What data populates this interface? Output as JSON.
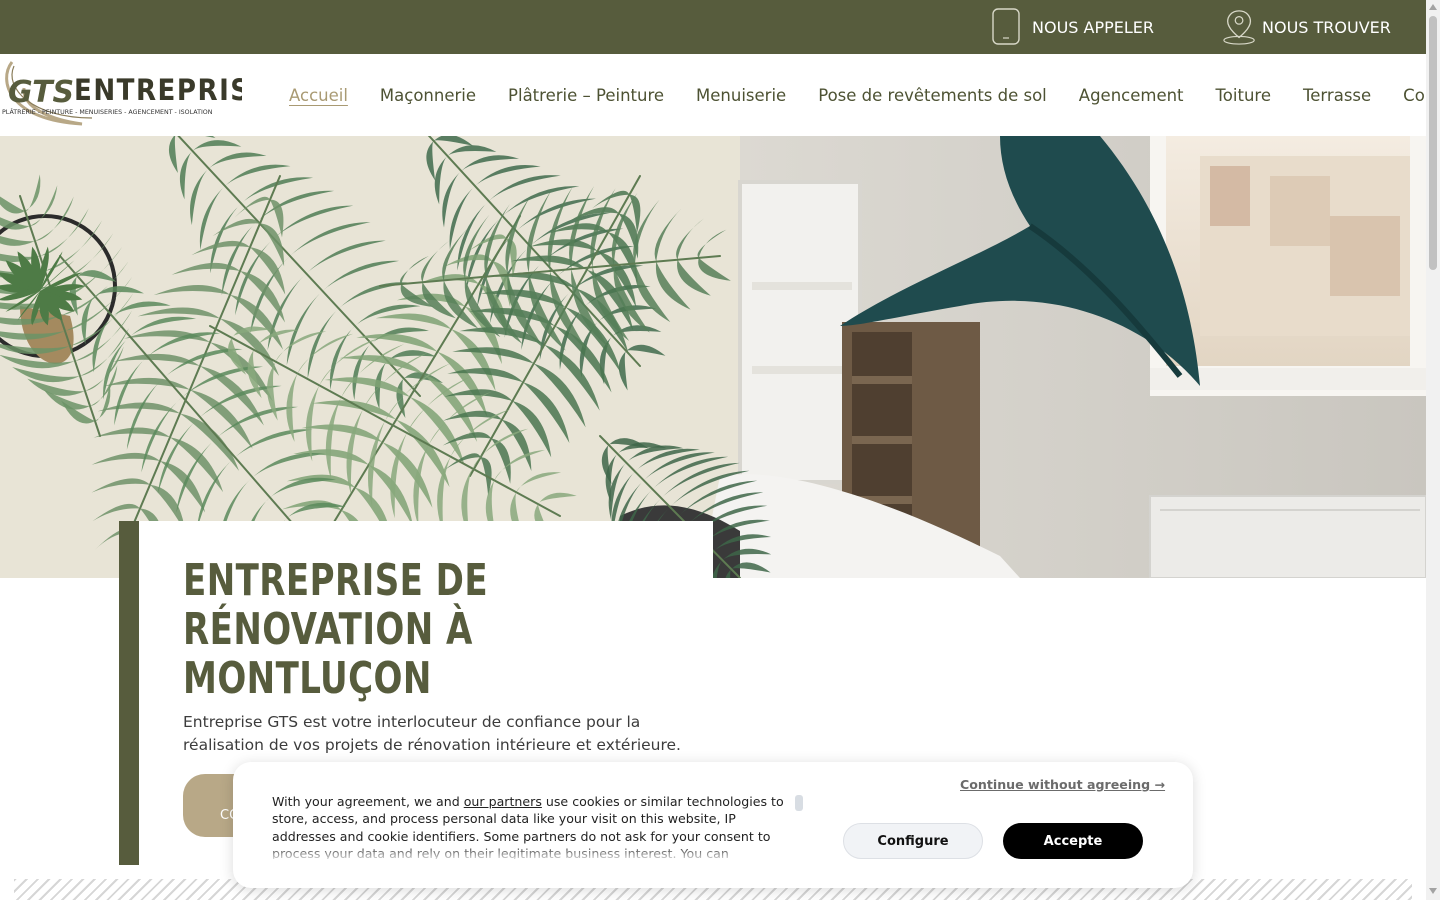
{
  "topbar": {
    "call_label": "NOUS APPELER",
    "call_icon": "phone-icon",
    "find_label": "NOUS TROUVER",
    "find_icon": "map-pin-icon",
    "background": "#575c3d"
  },
  "logo": {
    "monogram": "GTS",
    "name": "ENTREPRISE",
    "tagline": "PLÂTRERIE - PEINTURE - MENUISERIES - AGENCEMENT - ISOLATION"
  },
  "nav": {
    "items": [
      {
        "label": "Accueil",
        "active": true
      },
      {
        "label": "Maçonnerie",
        "active": false
      },
      {
        "label": "Plâtrerie – Peinture",
        "active": false
      },
      {
        "label": "Menuiserie",
        "active": false
      },
      {
        "label": "Pose de revêtements de sol",
        "active": false
      },
      {
        "label": "Agencement",
        "active": false
      },
      {
        "label": "Toiture",
        "active": false
      },
      {
        "label": "Terrasse",
        "active": false
      },
      {
        "label": "Contact",
        "active": false
      }
    ]
  },
  "hero": {
    "title": "ENTREPRISE DE RÉNOVATION À MONTLUÇON",
    "text": "Entreprise GTS est votre interlocuteur de confiance pour la réalisation de vos projets de rénovation intérieure et extérieure.",
    "cta_label": "CO"
  },
  "cookie": {
    "text_before_link": "With your agreement, we and ",
    "link_label": "our partners",
    "text_after_link": " use cookies or similar technologies to store, access, and process personal data like your visit on this website, IP addresses and cookie identifiers. Some partners do not ask for your consent to process your data and rely on their legitimate business interest. You can",
    "continue_label": "Continue without agreeing →",
    "configure_label": "Configure",
    "accept_label": "Accepte"
  },
  "colors": {
    "brand_olive": "#575c3d",
    "accent_gold": "#b8a887",
    "nav_active": "#a99a73"
  }
}
